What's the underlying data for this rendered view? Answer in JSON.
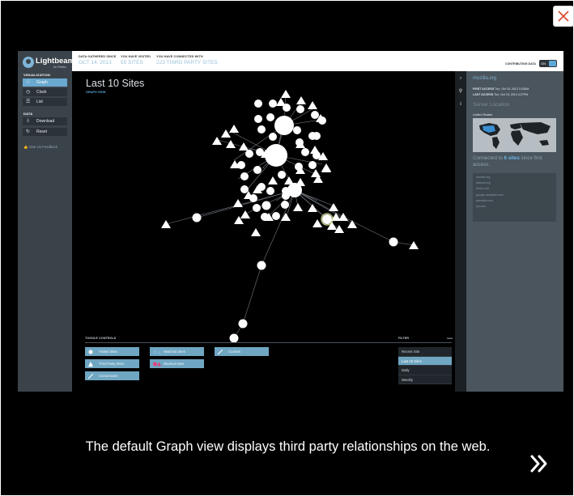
{
  "dialog": {
    "close_icon": "close-x-icon",
    "caption": "The default Graph view displays third party relationships on the web.",
    "next_icon": "double-chevron-right-icon"
  },
  "app": {
    "logo_text": "Lightbeam",
    "logo_sub": "for Firefox",
    "sidebar": {
      "visualization_heading": "VISUALIZATION",
      "visualization_items": [
        {
          "label": "Graph",
          "icon": "graph-icon",
          "active": true
        },
        {
          "label": "Clock",
          "icon": "clock-icon",
          "active": false
        },
        {
          "label": "List",
          "icon": "list-icon",
          "active": false
        }
      ],
      "data_heading": "DATA",
      "data_items": [
        {
          "label": "Download",
          "icon": "download-icon"
        },
        {
          "label": "Reset",
          "icon": "reset-icon"
        }
      ],
      "feedback": "Give Us Feedback"
    },
    "topbar": {
      "gathered_label": "DATA GATHERED SINCE",
      "gathered_value": "OCT 14, 2013",
      "visited_label": "YOU HAVE VISITED",
      "visited_value": "55 SITES",
      "connected_label": "YOU HAVE CONNECTED WITH",
      "connected_value": "223 THIRD PARTY SITES",
      "contributing_label": "CONTRIBUTING DATA",
      "toggle_label": "ON"
    },
    "main": {
      "title": "Last 10 Sites",
      "subtitle": "GRAPH VIEW",
      "toggle_controls_heading": "TOGGLE CONTROLS",
      "filter_heading": "FILTER",
      "filter_hint": "more",
      "controls": {
        "visited_sites": "Visited Sites",
        "watched_sites": "Watched Sites",
        "cookies": "Cookies",
        "third_party_sites": "Third Party Sites",
        "blocked_sites": "Blocked Sites",
        "connections": "Connections"
      },
      "filter_options": [
        "Recent Site",
        "Last 10 Sites",
        "Daily",
        "Weekly"
      ],
      "filter_selected": "Last 10 Sites"
    },
    "right_panel": {
      "site_name": "mozilla.org",
      "first_access_label": "FIRST ACCESS",
      "first_access_value": "Tue, Oct 15, 2013 3:33AM",
      "last_access_label": "LAST ACCESS",
      "last_access_value": "Tue, Oct 15, 2013 4:27PM",
      "server_location_heading": "Server Location",
      "country": "United States",
      "connected_prefix": "Connected to ",
      "connected_count": "6 sites",
      "connected_suffix": " since first access.",
      "connected_sites": [
        "mozilla.org",
        "akamai.org",
        "firefox.net",
        "google-analytics.com",
        "gravatar.com",
        "wp.com"
      ],
      "colors": {
        "accent": "#5fa9da",
        "panel": "#4a555d"
      }
    }
  }
}
